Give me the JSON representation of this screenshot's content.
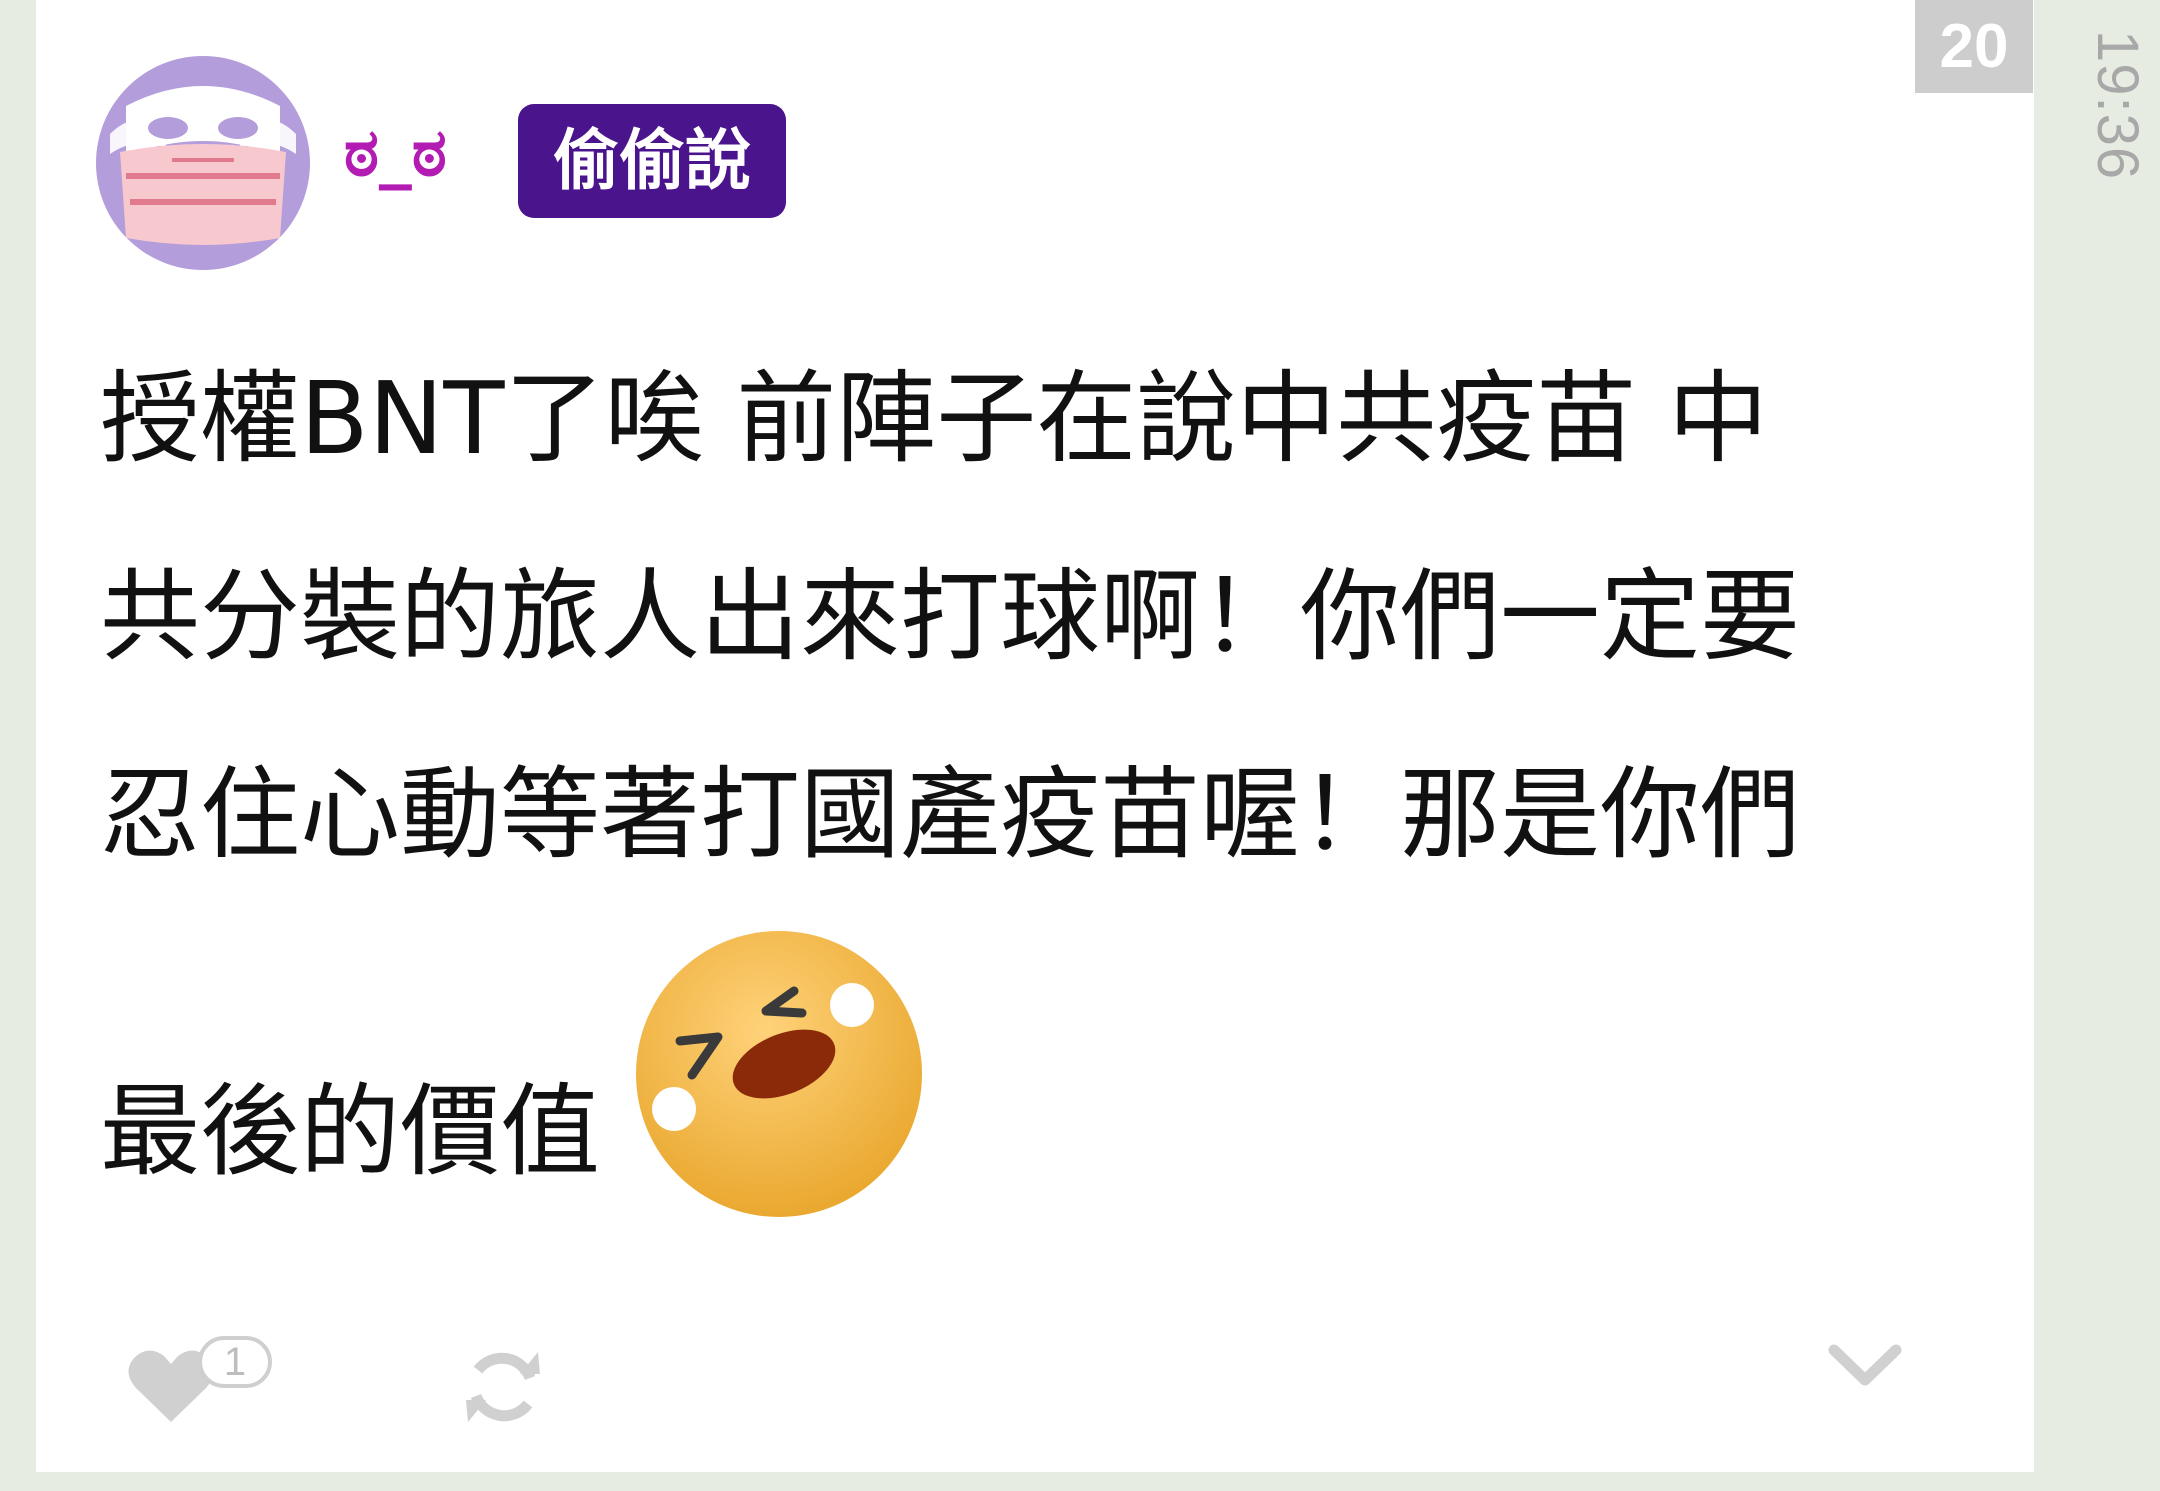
{
  "post": {
    "index": "20",
    "time": "19:36",
    "username": "ಠ_ಠ",
    "tag": "偷偷說",
    "body_lines": [
      "授權BNT了唉 前陣子在說中共疫苗 中",
      "共分裝的旅人出來打球啊！你們一定要",
      "忍住心動等著打國產疫苗喔！那是你們",
      "最後的價值"
    ],
    "emoji": "laughing-tears-emoji"
  },
  "actions": {
    "like_count": "1",
    "like_icon": "heart-icon",
    "repost_icon": "repost-icon",
    "expand_icon": "chevron-down-icon"
  },
  "colors": {
    "background": "#e7ece3",
    "card": "#ffffff",
    "username": "#b31cb3",
    "tag_bg": "#4a148c",
    "index_bg": "#cdcdcd",
    "icon_gray": "#d0d0d0"
  }
}
